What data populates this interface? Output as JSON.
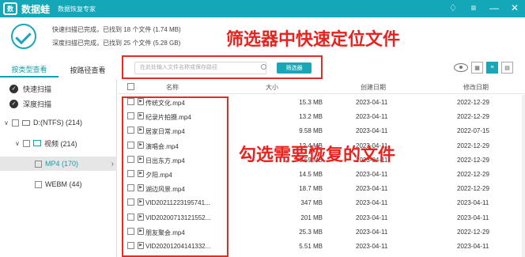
{
  "app": {
    "name": "数据蛙",
    "logo_text": "数",
    "subtitle": "数据恢复专家",
    "icons": [
      "logo-icon",
      "shirt-icon",
      "menu-icon",
      "minimize-icon",
      "close-icon"
    ]
  },
  "summary": {
    "quick_scan": "快速扫描已完成，已找到 18 个文件 (1.74 MB)",
    "deep_scan": "深度扫描已完成，已找到 25 个文件 (5.28 GB)"
  },
  "annotations": {
    "top": "筛选器中快速定位文件",
    "middle": "勾选需要恢复的文件"
  },
  "tabs": [
    {
      "label": "按类型查看"
    },
    {
      "label": "按路径查看"
    }
  ],
  "search": {
    "placeholder": "在此处输入文件名称或保存路径",
    "button": "筛选器"
  },
  "tree": {
    "quick_scan": "快速扫描",
    "deep_scan": "深度扫描",
    "drive": "D:(NTFS) (214)",
    "video": "视频 (214)",
    "mp4": "MP4 (170)",
    "webm": "WEBM (44)"
  },
  "table": {
    "columns": [
      "名称",
      "大小",
      "创建日期",
      "修改日期"
    ],
    "rows": [
      {
        "name": "传统文化.mp4",
        "size": "15.3 MB",
        "created": "2023-04-11",
        "modified": "2022-12-29"
      },
      {
        "name": "纪录片拍摄.mp4",
        "size": "13.2 MB",
        "created": "2023-04-11",
        "modified": "2022-12-29"
      },
      {
        "name": "居家日常.mp4",
        "size": "9.58 MB",
        "created": "2023-04-11",
        "modified": "2022-07-15"
      },
      {
        "name": "演唱会.mp4",
        "size": "12.4 MB",
        "created": "2023-04-11",
        "modified": "2022-12-29"
      },
      {
        "name": "日出东方.mp4",
        "size": "6.59 MB",
        "created": "2023-04-11",
        "modified": "2022-12-29"
      },
      {
        "name": "夕阳.mp4",
        "size": "14.5 MB",
        "created": "2023-04-11",
        "modified": "2022-12-29"
      },
      {
        "name": "湖边风景.mp4",
        "size": "18.7 MB",
        "created": "2023-04-11",
        "modified": "2022-12-29"
      },
      {
        "name": "VID20211223195741...",
        "size": "347 MB",
        "created": "2023-04-11",
        "modified": "2023-04-11"
      },
      {
        "name": "VID20200713121552...",
        "size": "201 MB",
        "created": "2023-04-11",
        "modified": "2023-04-11"
      },
      {
        "name": "朋友聚会.mp4",
        "size": "25.3 MB",
        "created": "2023-04-11",
        "modified": "2022-12-29"
      },
      {
        "name": "VID20201204141332...",
        "size": "5.51 MB",
        "created": "2023-04-11",
        "modified": "2023-04-11"
      }
    ]
  }
}
